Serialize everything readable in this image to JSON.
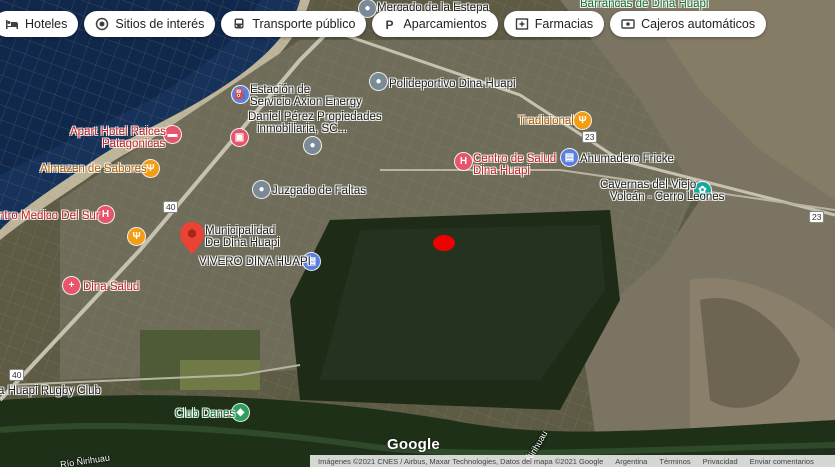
{
  "chips": [
    {
      "icon": "bed-icon",
      "label": "Hoteles"
    },
    {
      "icon": "camera-icon",
      "label": "Sitios de interés"
    },
    {
      "icon": "bus-icon",
      "label": "Transporte público"
    },
    {
      "icon": "parking-icon",
      "label": "Aparcamientos"
    },
    {
      "icon": "pharmacy-icon",
      "label": "Farmacias"
    },
    {
      "icon": "atm-icon",
      "label": "Cajeros automáticos"
    }
  ],
  "places": {
    "mercado": "Mercado de la Estepa",
    "barrancas": "Barrancas de Dina Huapi",
    "estacion_1": "Estación de",
    "estacion_2": "Servicio Axion Energy",
    "polideportivo": "Polideportivo Dina Huapi",
    "daniel_1": "Daniel Pérez Propiedades",
    "daniel_2": "inmobiliaria, SC...",
    "apart_1": "Apart Hotel Raices",
    "apart_2": "Patagonicas",
    "tradicional": "Tradicional",
    "centro_salud_1": "Centro de Salud",
    "centro_salud_2": "Dina Huapi",
    "ahumadero": "Ahumadero Fricke",
    "almazen": "Almazen de Sabores",
    "juzgado": "Juzgado de Faltas",
    "cavernas_1": "Cavernas del Viejo",
    "cavernas_2": "Volcán - Cerro Leones",
    "centro_medico": "ntro Medico Del Sur",
    "municipalidad_1": "Municipalidad",
    "municipalidad_2": "De Dina Huapi",
    "vivero": "VIVERO DINA HUAPI",
    "dina_salud": "Dina Salud",
    "rugby": "a Huapi Rugby Club",
    "club_danes": "Club Danes",
    "rio": "Río Ñirihuau",
    "nirihuau": "Ñirihuau"
  },
  "routes": {
    "r23a": "23",
    "r23b": "23",
    "r40a": "40",
    "r40b": "40"
  },
  "google_logo": "Google",
  "footer": {
    "imagery": "Imágenes ©2021 CNES / Airbus, Maxar Technologies, Datos del mapa ©2021 Google",
    "country": "Argentina",
    "terms": "Términos",
    "privacy": "Privacidad",
    "feedback": "Enviar comentarios"
  }
}
